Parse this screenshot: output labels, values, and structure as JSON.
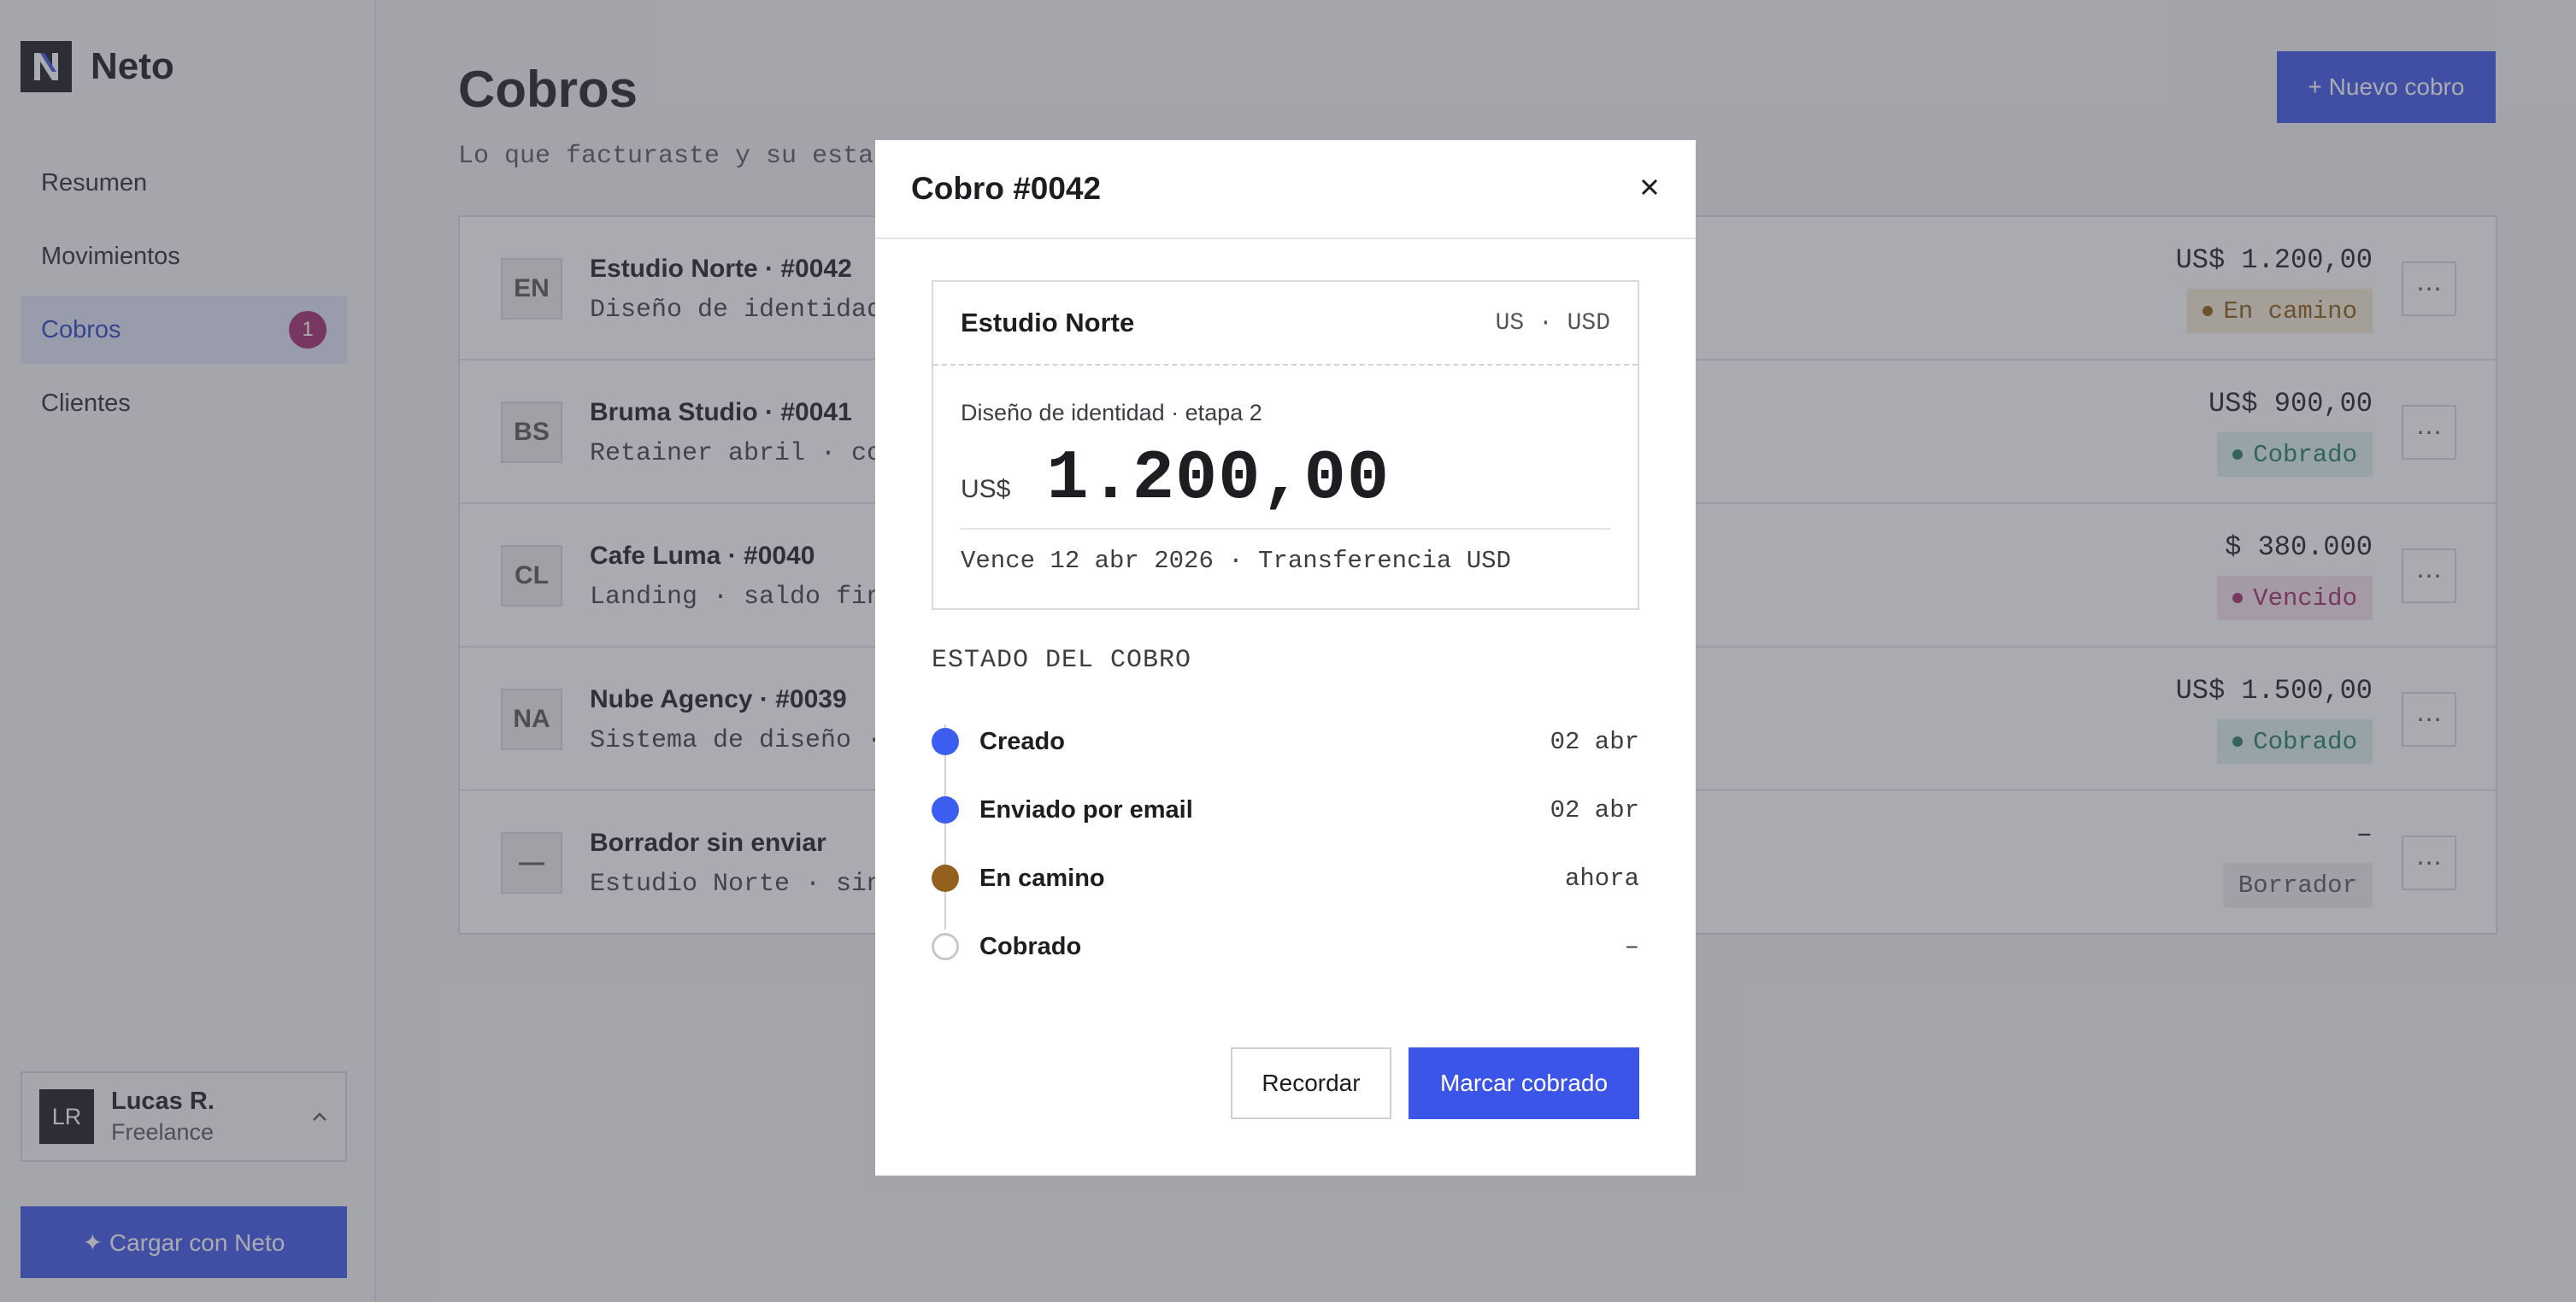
{
  "sidebar": {
    "brand": "Neto",
    "items": [
      {
        "label": "Resumen",
        "active": false
      },
      {
        "label": "Movimientos",
        "active": false
      },
      {
        "label": "Cobros",
        "active": true,
        "badge": "1"
      },
      {
        "label": "Clientes",
        "active": false
      }
    ],
    "user": {
      "initials": "LR",
      "name": "Lucas R.",
      "role": "Freelance"
    },
    "cta": "✦ Cargar con Neto"
  },
  "header": {
    "title": "Cobros",
    "subtitle": "Lo que facturaste y su estado",
    "new_button": "+ Nuevo cobro"
  },
  "rows": [
    {
      "initials": "EN",
      "title": "Estudio Norte · #0042",
      "subtitle": "Diseño de identidad",
      "amount": "US$ 1.200,00",
      "status": "En camino",
      "status_kind": "camino"
    },
    {
      "initials": "BS",
      "title": "Bruma Studio · #0041",
      "subtitle": "Retainer abril · cob",
      "amount": "US$ 900,00",
      "status": "Cobrado",
      "status_kind": "cobrado"
    },
    {
      "initials": "CL",
      "title": "Cafe Luma · #0040",
      "subtitle": "Landing · saldo fina",
      "amount": "$ 380.000",
      "status": "Vencido",
      "status_kind": "vencido"
    },
    {
      "initials": "NA",
      "title": "Nube Agency · #0039",
      "subtitle": "Sistema de diseño ·",
      "amount": "US$ 1.500,00",
      "status": "Cobrado",
      "status_kind": "cobrado"
    },
    {
      "initials": "—",
      "title": "Borrador sin enviar",
      "subtitle": "Estudio Norte · sin",
      "amount": "–",
      "status": "Borrador",
      "status_kind": "borrador"
    }
  ],
  "more_label": "⋯",
  "modal": {
    "title": "Cobro #0042",
    "close": "×",
    "client": "Estudio Norte",
    "currency_tag": "US · USD",
    "description": "Diseño de identidad · etapa 2",
    "currency_prefix": "US$",
    "amount": "1.200,00",
    "footer": "Vence 12 abr 2026 · Transferencia USD",
    "timeline_title": "ESTADO DEL COBRO",
    "timeline": [
      {
        "label": "Creado",
        "date": "02 abr",
        "state": "done"
      },
      {
        "label": "Enviado por email",
        "date": "02 abr",
        "state": "done"
      },
      {
        "label": "En camino",
        "date": "ahora",
        "state": "current"
      },
      {
        "label": "Cobrado",
        "date": "–",
        "state": "todo"
      }
    ],
    "secondary_button": "Recordar",
    "primary_button": "Marcar cobrado"
  },
  "colors": {
    "accent": "#3b55e8",
    "status_camino": "#8a5c10",
    "status_cobrado": "#227a66",
    "status_vencido": "#a12a6c",
    "timeline_done": "#3b5ef0",
    "timeline_current": "#93601d"
  }
}
